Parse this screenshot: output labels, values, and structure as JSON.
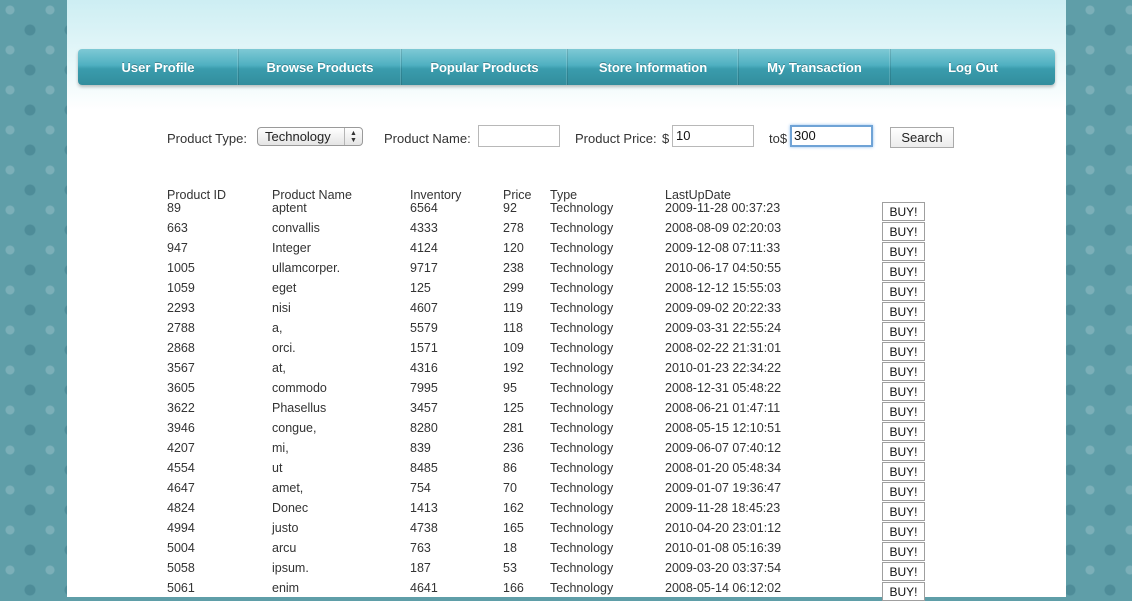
{
  "nav": [
    {
      "label": "User Profile",
      "width": 161
    },
    {
      "label": "Browse Products",
      "width": 163
    },
    {
      "label": "Popular Products",
      "width": 166
    },
    {
      "label": "Store Information",
      "width": 171
    },
    {
      "label": "My Transaction",
      "width": 152
    },
    {
      "label": "Log Out",
      "width": 164
    }
  ],
  "search": {
    "product_type_label": "Product Type:",
    "product_type_value": "Technology",
    "product_name_label": "Product Name:",
    "product_name_value": "",
    "product_price_label": "Product Price:",
    "dollar_symbol": "$",
    "price_from_value": "10",
    "to_label": "to$",
    "price_to_value": "300",
    "search_button": "Search"
  },
  "table": {
    "headers": [
      "Product ID",
      "Product Name",
      "Inventory",
      "Price",
      "Type",
      "LastUpDate"
    ],
    "buy_label": "BUY!",
    "rows": [
      [
        "89",
        "aptent",
        "6564",
        "92",
        "Technology",
        "2009-11-28 00:37:23"
      ],
      [
        "663",
        "convallis",
        "4333",
        "278",
        "Technology",
        "2008-08-09 02:20:03"
      ],
      [
        "947",
        "Integer",
        "4124",
        "120",
        "Technology",
        "2009-12-08 07:11:33"
      ],
      [
        "1005",
        "ullamcorper.",
        "9717",
        "238",
        "Technology",
        "2010-06-17 04:50:55"
      ],
      [
        "1059",
        "eget",
        "125",
        "299",
        "Technology",
        "2008-12-12 15:55:03"
      ],
      [
        "2293",
        "nisi",
        "4607",
        "119",
        "Technology",
        "2009-09-02 20:22:33"
      ],
      [
        "2788",
        "a,",
        "5579",
        "118",
        "Technology",
        "2009-03-31 22:55:24"
      ],
      [
        "2868",
        "orci.",
        "1571",
        "109",
        "Technology",
        "2008-02-22 21:31:01"
      ],
      [
        "3567",
        "at,",
        "4316",
        "192",
        "Technology",
        "2010-01-23 22:34:22"
      ],
      [
        "3605",
        "commodo",
        "7995",
        "95",
        "Technology",
        "2008-12-31 05:48:22"
      ],
      [
        "3622",
        "Phasellus",
        "3457",
        "125",
        "Technology",
        "2008-06-21 01:47:11"
      ],
      [
        "3946",
        "congue,",
        "8280",
        "281",
        "Technology",
        "2008-05-15 12:10:51"
      ],
      [
        "4207",
        "mi,",
        "839",
        "236",
        "Technology",
        "2009-06-07 07:40:12"
      ],
      [
        "4554",
        "ut",
        "8485",
        "86",
        "Technology",
        "2008-01-20 05:48:34"
      ],
      [
        "4647",
        "amet,",
        "754",
        "70",
        "Technology",
        "2009-01-07 19:36:47"
      ],
      [
        "4824",
        "Donec",
        "1413",
        "162",
        "Technology",
        "2009-11-28 18:45:23"
      ],
      [
        "4994",
        "justo",
        "4738",
        "165",
        "Technology",
        "2010-04-20 23:01:12"
      ],
      [
        "5004",
        "arcu",
        "763",
        "18",
        "Technology",
        "2010-01-08 05:16:39"
      ],
      [
        "5058",
        "ipsum.",
        "187",
        "53",
        "Technology",
        "2009-03-20 03:37:54"
      ],
      [
        "5061",
        "enim",
        "4641",
        "166",
        "Technology",
        "2008-05-14 06:12:02"
      ]
    ]
  }
}
